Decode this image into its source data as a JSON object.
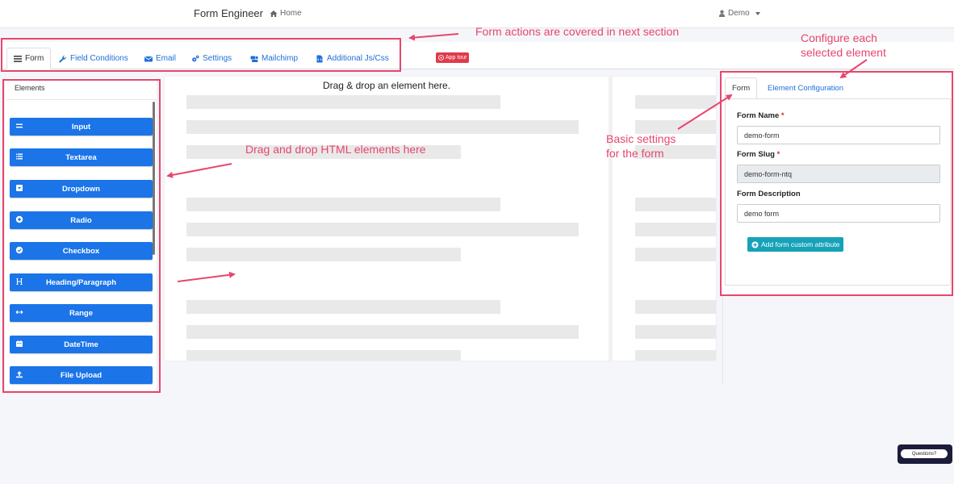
{
  "navbar": {
    "brand": "Form Engineer",
    "home": "Home",
    "user": "Demo"
  },
  "tabs": [
    {
      "label": "Form",
      "icon": "list-icon"
    },
    {
      "label": "Field Conditions",
      "icon": "wrench-icon"
    },
    {
      "label": "Email",
      "icon": "envelope-icon"
    },
    {
      "label": "Settings",
      "icon": "gears-icon"
    },
    {
      "label": "Mailchimp",
      "icon": "mailchimp-icon"
    },
    {
      "label": "Additional Js/Css",
      "icon": "file-code-icon"
    }
  ],
  "app_tour": "App tour",
  "elements": {
    "title": "Elements",
    "items": [
      {
        "label": "Input",
        "icon": "equals-icon"
      },
      {
        "label": "Textarea",
        "icon": "list-icon"
      },
      {
        "label": "Dropdown",
        "icon": "caret-square-down-icon"
      },
      {
        "label": "Radio",
        "icon": "dot-circle-icon"
      },
      {
        "label": "Checkbox",
        "icon": "check-circle-icon"
      },
      {
        "label": "Heading/Paragraph",
        "icon": "heading-icon"
      },
      {
        "label": "Range",
        "icon": "arrows-h-icon"
      },
      {
        "label": "DateTime",
        "icon": "calendar-icon"
      },
      {
        "label": "File Upload",
        "icon": "upload-icon"
      }
    ]
  },
  "canvas": {
    "drop_hint": "Drag & drop an element here."
  },
  "config": {
    "tabs": [
      "Form",
      "Element Configuration"
    ],
    "form_name_label": "Form Name",
    "form_name_value": "demo-form",
    "form_slug_label": "Form Slug",
    "form_slug_value": "demo-form-ntq",
    "form_description_label": "Form Description",
    "form_description_value": "demo form",
    "add_attribute": "Add form custom attribute"
  },
  "annotations": {
    "form_actions": "Form actions are covered in next section",
    "configure_line1": "Configure each",
    "configure_line2": "selected element",
    "basic_line1": "Basic settings",
    "basic_line2": "for the form",
    "drag_drop": "Drag and drop HTML elements here"
  },
  "help": {
    "questions": "Questions?"
  },
  "colors": {
    "accent": "#1b74e8",
    "annotation": "#e8466d",
    "app_tour": "#e03a4b",
    "info_button": "#16a2b8"
  }
}
